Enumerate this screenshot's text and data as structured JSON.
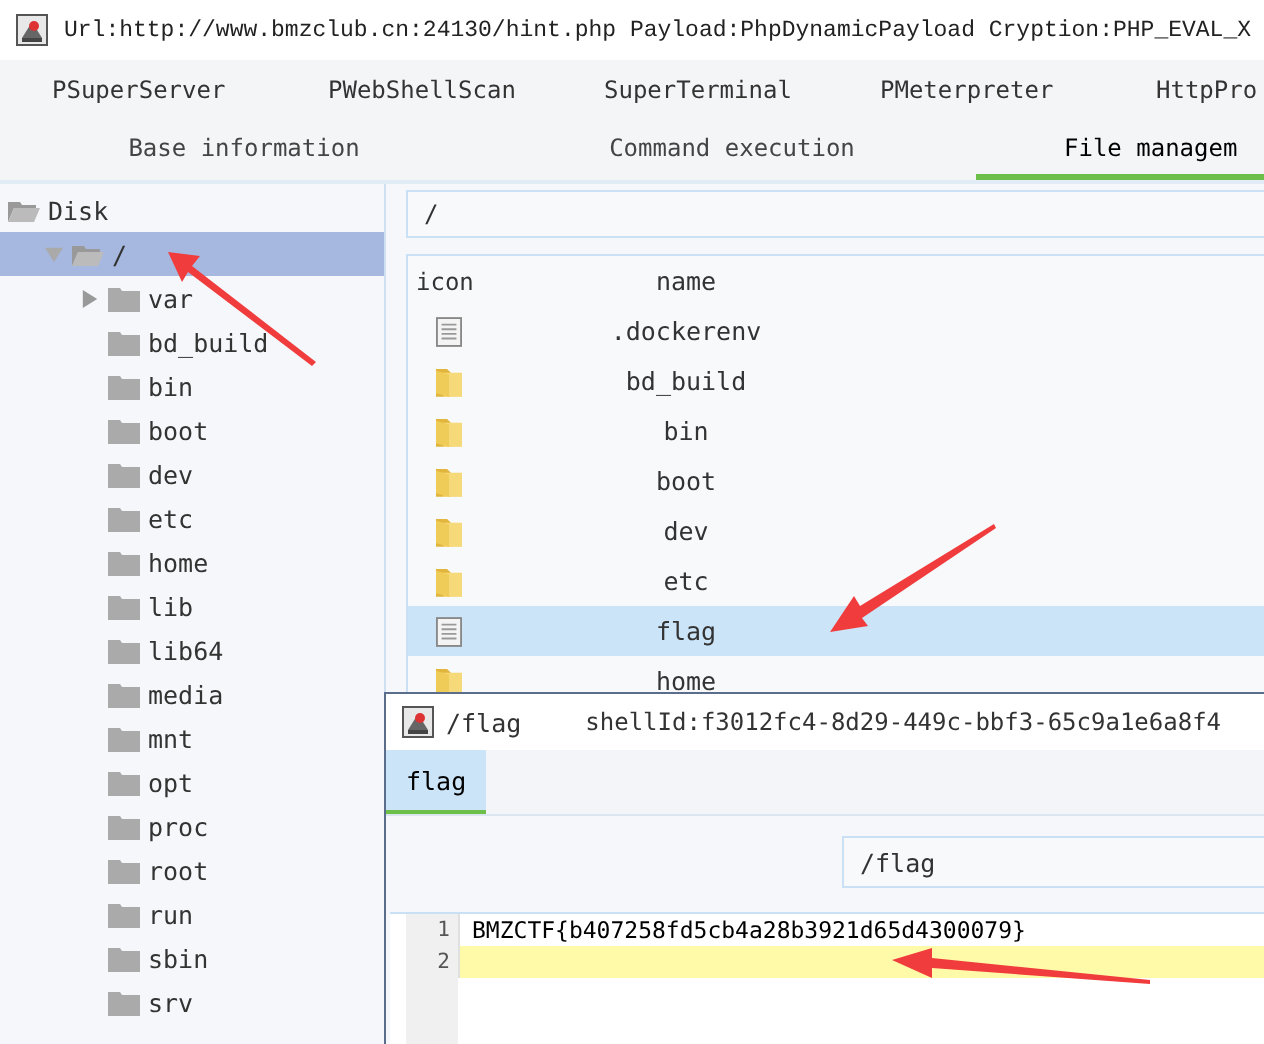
{
  "window": {
    "title": "Url:http://www.bmzclub.cn:24130/hint.php Payload:PhpDynamicPayload Cryption:PHP_EVAL_X"
  },
  "top_tabs": [
    {
      "label": "PSuperServer",
      "selected": false
    },
    {
      "label": "PWebShellScan",
      "selected": false
    },
    {
      "label": "SuperTerminal",
      "selected": false
    },
    {
      "label": "PMeterpreter",
      "selected": false
    },
    {
      "label": "HttpPro",
      "selected": false
    }
  ],
  "sub_tabs": [
    {
      "label": "Base information",
      "selected": false
    },
    {
      "label": "Command execution",
      "selected": false
    },
    {
      "label": "File managem",
      "selected": true
    }
  ],
  "sidebar": {
    "items": [
      {
        "label": "Disk",
        "expanded": true,
        "selected": false,
        "children": [
          {
            "label": "/",
            "expanded": true,
            "selected": true,
            "children": [
              {
                "label": "var",
                "expanded": false,
                "selected": false,
                "has_children": true
              },
              {
                "label": "bd_build",
                "selected": false
              },
              {
                "label": "bin",
                "selected": false
              },
              {
                "label": "boot",
                "selected": false
              },
              {
                "label": "dev",
                "selected": false
              },
              {
                "label": "etc",
                "selected": false
              },
              {
                "label": "home",
                "selected": false
              },
              {
                "label": "lib",
                "selected": false
              },
              {
                "label": "lib64",
                "selected": false
              },
              {
                "label": "media",
                "selected": false
              },
              {
                "label": "mnt",
                "selected": false
              },
              {
                "label": "opt",
                "selected": false
              },
              {
                "label": "proc",
                "selected": false
              },
              {
                "label": "root",
                "selected": false
              },
              {
                "label": "run",
                "selected": false
              },
              {
                "label": "sbin",
                "selected": false
              },
              {
                "label": "srv",
                "selected": false
              }
            ]
          }
        ]
      }
    ]
  },
  "path_field": {
    "value": "/"
  },
  "file_table": {
    "columns": [
      "icon",
      "name"
    ],
    "rows": [
      {
        "kind": "file",
        "name": ".dockerenv",
        "selected": false
      },
      {
        "kind": "folder",
        "name": "bd_build",
        "selected": false
      },
      {
        "kind": "folder",
        "name": "bin",
        "selected": false
      },
      {
        "kind": "folder",
        "name": "boot",
        "selected": false
      },
      {
        "kind": "folder",
        "name": "dev",
        "selected": false
      },
      {
        "kind": "folder",
        "name": "etc",
        "selected": false
      },
      {
        "kind": "file",
        "name": "flag",
        "selected": true
      },
      {
        "kind": "folder",
        "name": "home",
        "selected": false
      }
    ]
  },
  "editor_window": {
    "title": "/flag",
    "shell_id": "shellId:f3012fc4-8d29-449c-bbf3-65c9a1e6a8f4",
    "tabs": [
      {
        "label": "flag",
        "selected": true
      }
    ],
    "path_field": {
      "value": "/flag"
    },
    "lines": [
      {
        "number": "1",
        "text": "BMZCTF{b407258fd5cb4a28b3921d65d4300079}",
        "current": false
      },
      {
        "number": "2",
        "current": true
      }
    ]
  }
}
